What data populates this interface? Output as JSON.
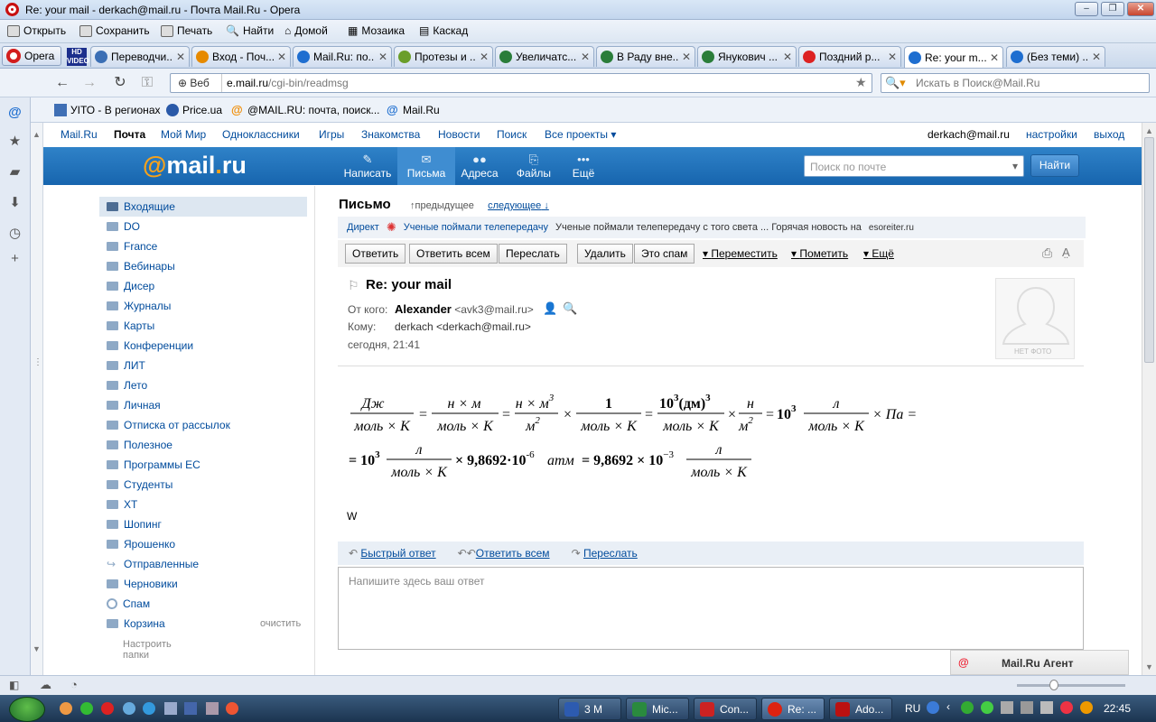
{
  "window": {
    "title": "Re: your mail - derkach@mail.ru - Почта Mail.Ru - Opera"
  },
  "menubar": [
    {
      "label": "Открыть",
      "icon": "open-icon"
    },
    {
      "label": "Сохранить",
      "icon": "save-icon"
    },
    {
      "label": "Печать",
      "icon": "print-icon"
    },
    {
      "label": "Найти",
      "icon": "find-icon"
    },
    {
      "label": "Домой",
      "icon": "home-icon"
    },
    {
      "label": "Мозаика",
      "icon": "tile-icon"
    },
    {
      "label": "Каскад",
      "icon": "cascade-icon"
    }
  ],
  "tabs": {
    "opera_label": "Opera",
    "items": [
      {
        "label": "Переводчи...",
        "close": "✕"
      },
      {
        "label": "Вход - Поч...",
        "close": "✕"
      },
      {
        "label": "Mail.Ru: по...",
        "close": "✕"
      },
      {
        "label": "Протезы и ...",
        "close": "✕"
      },
      {
        "label": "Увеличатс...",
        "close": "✕"
      },
      {
        "label": "В Раду вне...",
        "close": "✕"
      },
      {
        "label": "Янукович ...",
        "close": "✕"
      },
      {
        "label": "Поздний р...",
        "close": "✕"
      },
      {
        "label": "Re: your m...",
        "close": "✕"
      },
      {
        "label": "(Без теми) ...",
        "close": "✕"
      }
    ]
  },
  "address": {
    "badge": "Веб",
    "url_host": "e.mail.ru",
    "url_path": "/cgi-bin/readmsg",
    "search_placeholder": "Искать в Поиск@Mail.Ru"
  },
  "bookmarks": [
    "УІТО - В регионах",
    "Price.ua",
    "@MAIL.RU: почта, поиск...",
    "Mail.Ru"
  ],
  "topnav": {
    "items": [
      "Mail.Ru",
      "Почта",
      "Мой Мир",
      "Одноклассники",
      "Игры",
      "Знакомства",
      "Новости",
      "Поиск",
      "Все проекты"
    ],
    "user": "derkach@mail.ru",
    "settings": "настройки",
    "logout": "выход"
  },
  "header": {
    "logo_at": "@",
    "logo_text": "mail",
    "logo_dot": ".",
    "logo_ru": "ru",
    "nav": [
      {
        "label": "Написать",
        "icon": "pencil-icon",
        "glyph": "✎"
      },
      {
        "label": "Письма",
        "icon": "envelope-icon",
        "glyph": "✉"
      },
      {
        "label": "Адреса",
        "icon": "contacts-icon",
        "glyph": "👥"
      },
      {
        "label": "Файлы",
        "icon": "paperclip-icon",
        "glyph": "📎"
      },
      {
        "label": "Ещё",
        "icon": "more-icon",
        "glyph": "•••"
      }
    ],
    "search_placeholder": "Поиск по почте",
    "search_button": "Найти"
  },
  "folders": [
    "Входящие",
    "DO",
    "France",
    "Вебинары",
    "Дисер",
    "Журналы",
    "Карты",
    "Конференции",
    "ЛИТ",
    "Лето",
    "Личная",
    "Отписка от рассылок",
    "Полезное",
    "Программы ЕС",
    "Студенты",
    "ХТ",
    "Шопинг",
    "Ярошенко",
    "Отправленные",
    "Черновики",
    "Спам",
    "Корзина"
  ],
  "folder_clear": "очистить",
  "folder_settings": "Настроить папки",
  "message": {
    "section_title": "Письмо",
    "prev": "предыдущее",
    "next": "следующее",
    "direct": {
      "label": "Директ",
      "link": "Ученые поймали телепередачу",
      "text": "Ученые поймали телепередачу с того света ... Горячая новость на",
      "domain": "esoreiter.ru"
    },
    "actions": [
      "Ответить",
      "Ответить всем",
      "Переслать",
      "Удалить",
      "Это спам"
    ],
    "action_links": [
      "Переместить",
      "Пометить",
      "Ещё"
    ],
    "subject": "Re: your mail",
    "from_label": "От кого:",
    "from_name": "Alexander",
    "from_email": "<avk3@mail.ru>",
    "to_label": "Кому:",
    "to_value": "derkach <derkach@mail.ru>",
    "date": "сегодня, 21:41",
    "no_photo": "НЕТ ФОТО",
    "body_text": "W",
    "reply_links": [
      "Быстрый ответ",
      "Ответить всем",
      "Переслать"
    ],
    "reply_placeholder": "Напишите здесь ваш ответ"
  },
  "formula": {
    "f1n": "Дж",
    "f1d": "моль × К",
    "f2n": "н × м",
    "f2d": "моль × К",
    "f3n": "н × м",
    "f3ne": "3",
    "f3d": "м",
    "f3de": "2",
    "f4n": "1",
    "f4d": "моль × К",
    "f5n_a": "10",
    "f5n_e": "3",
    "f5n_b": "(дм)",
    "f5n_e2": "3",
    "f5d": "моль × К",
    "f6n": "н",
    "f6d": "м",
    "f6de": "2",
    "t7": "10",
    "t7e": "3",
    "f8n": "л",
    "f8d": "моль × К",
    "t9": "× Па =",
    "r2a": "= 10",
    "r2ae": "3",
    "r2fn": "л",
    "r2fd": "моль × К",
    "r2b": "× 9,8692·10",
    "r2be": "-6",
    "r2c": "атм",
    "r2d": "= 9,8692 × 10",
    "r2de": "−3",
    "r2gn": "л",
    "r2gd": "моль × К"
  },
  "agent": {
    "label": "Mail.Ru Агент"
  },
  "taskbar": {
    "items": [
      "3 M",
      "Mic...",
      "Con...",
      "Re: ...",
      "Ado..."
    ],
    "lang": "RU",
    "clock": "22:45"
  }
}
